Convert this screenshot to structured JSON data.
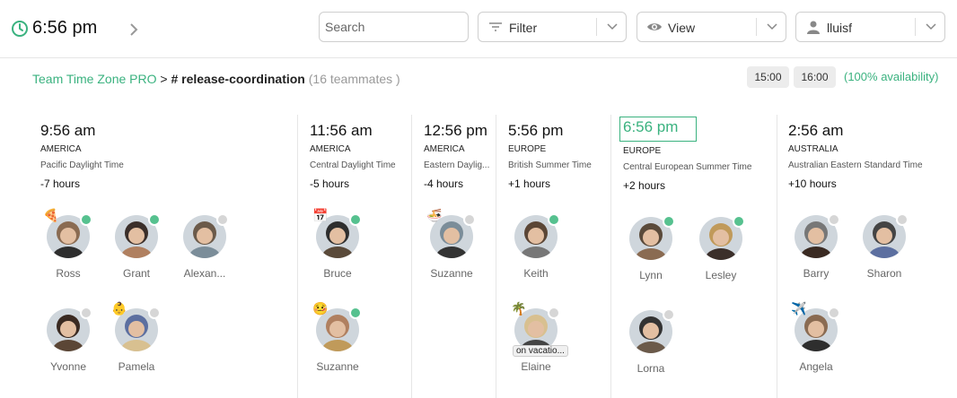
{
  "header": {
    "current_time": "6:56 pm",
    "search_placeholder": "Search",
    "filter_label": "Filter",
    "view_label": "View",
    "user_label": "lluisf"
  },
  "breadcrumb": {
    "brand": "Team Time Zone PRO",
    "separator": ">",
    "channel": "# release-coordination",
    "count": "(16 teammates )"
  },
  "availability": {
    "start": "15:00",
    "end": "16:00",
    "label": "(100%  availability)"
  },
  "colors": {
    "accent": "#3ab27f",
    "online": "#56c18f",
    "offline": "#d6d6d6"
  },
  "zones": [
    {
      "time": "9:56 am",
      "region": "AMERICA",
      "name": "Pacific Daylight Time",
      "offset": "-7 hours",
      "mates": [
        {
          "name": "Ross",
          "online": true,
          "emoji": "🍕"
        },
        {
          "name": "Grant",
          "online": true,
          "emoji": ""
        },
        {
          "name": "Alexan...",
          "online": false,
          "emoji": ""
        },
        {
          "name": "Yvonne",
          "online": false,
          "emoji": ""
        },
        {
          "name": "Pamela",
          "online": false,
          "emoji": "👶"
        }
      ]
    },
    {
      "time": "11:56 am",
      "region": "AMERICA",
      "name": "Central Daylight Time",
      "offset": "-5 hours",
      "mates": [
        {
          "name": "Bruce",
          "online": true,
          "emoji": "📅"
        },
        {
          "name": "Suzanne",
          "online": true,
          "emoji": "🤒"
        }
      ]
    },
    {
      "time": "12:56 pm",
      "region": "AMERICA",
      "name": "Eastern Daylig...",
      "offset": "-4 hours",
      "mates": [
        {
          "name": "Suzanne",
          "online": false,
          "emoji": "🍜"
        }
      ]
    },
    {
      "time": "5:56 pm",
      "region": "EUROPE",
      "name": "British Summer Time",
      "offset": "+1 hours",
      "mates": [
        {
          "name": "Keith",
          "online": true,
          "emoji": ""
        },
        {
          "name": "Elaine",
          "online": false,
          "emoji": "🌴",
          "status": "on vacatio..."
        }
      ]
    },
    {
      "time": "6:56 pm",
      "region": "EUROPE",
      "name": "Central European Summer Time",
      "offset": "+2 hours",
      "mates": [
        {
          "name": "Lynn",
          "online": true,
          "emoji": ""
        },
        {
          "name": "Lesley",
          "online": true,
          "emoji": ""
        },
        {
          "name": "Lorna",
          "online": false,
          "emoji": ""
        }
      ]
    },
    {
      "time": "2:56 am",
      "region": "AUSTRALIA",
      "name": "Australian Eastern Standard Time",
      "offset": "+10 hours",
      "mates": [
        {
          "name": "Barry",
          "online": false,
          "emoji": ""
        },
        {
          "name": "Sharon",
          "online": false,
          "emoji": ""
        },
        {
          "name": "Angela",
          "online": false,
          "emoji": "✈️"
        }
      ]
    }
  ]
}
